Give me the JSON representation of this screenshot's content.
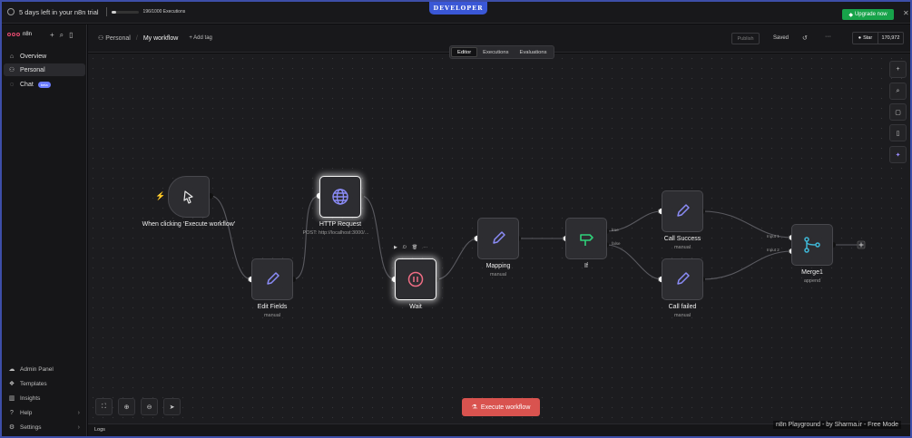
{
  "topbar": {
    "trial_text": "5 days left in your n8n trial",
    "executions": "196/1000 Executions",
    "executions_fraction": 0.196,
    "environment_badge": "DEVELOPER",
    "upgrade_label": "Upgrade now",
    "close_icon": "close-icon"
  },
  "sidebar": {
    "brand": "n8n",
    "nav": [
      {
        "label": "Overview",
        "icon": "home-icon"
      },
      {
        "label": "Personal",
        "icon": "user-icon"
      },
      {
        "label": "Chat",
        "icon": "chat-icon",
        "badge": "beta"
      }
    ],
    "bottom": [
      {
        "label": "Admin Panel",
        "icon": "cloud-icon"
      },
      {
        "label": "Templates",
        "icon": "templates-icon"
      },
      {
        "label": "Insights",
        "icon": "insights-icon"
      },
      {
        "label": "Help",
        "icon": "help-icon"
      },
      {
        "label": "Settings",
        "icon": "settings-icon"
      }
    ]
  },
  "header": {
    "project": "Personal",
    "workflow_name": "My workflow",
    "add_tag": "+ Add tag",
    "publish": "Publish",
    "status": "Saved",
    "github_star": "Star",
    "star_count": "170,972"
  },
  "tabs": [
    "Editor",
    "Executions",
    "Evaluations"
  ],
  "nodes": {
    "trigger": {
      "title": "When clicking ‘Execute workflow’"
    },
    "edit_fields": {
      "title": "Edit Fields",
      "subtitle": "manual"
    },
    "http": {
      "title": "HTTP Request",
      "subtitle": "POST: http://localhost:3000/..."
    },
    "wait": {
      "title": "Wait"
    },
    "mapping": {
      "title": "Mapping",
      "subtitle": "manual"
    },
    "if": {
      "title": "If",
      "true_label": "true",
      "false_label": "false"
    },
    "call_success": {
      "title": "Call Success",
      "subtitle": "manual"
    },
    "call_failed": {
      "title": "Call failed",
      "subtitle": "manual"
    },
    "merge": {
      "title": "Merge1",
      "subtitle": "append",
      "input1": "Input 1",
      "input2": "Input 2"
    }
  },
  "execute_button": "Execute workflow",
  "logs_label": "Logs",
  "watermark": "n8n Playground - by Sharma.ir - Free Mode",
  "colors": {
    "accent_green": "#17a34a",
    "execute_red": "#d9534f",
    "edit_purple": "#8b8cf7",
    "wait_pink": "#ef6d84",
    "if_green": "#2fd27a",
    "merge_teal": "#3fb7d6",
    "dev_badge_blue": "#3a57d6"
  }
}
